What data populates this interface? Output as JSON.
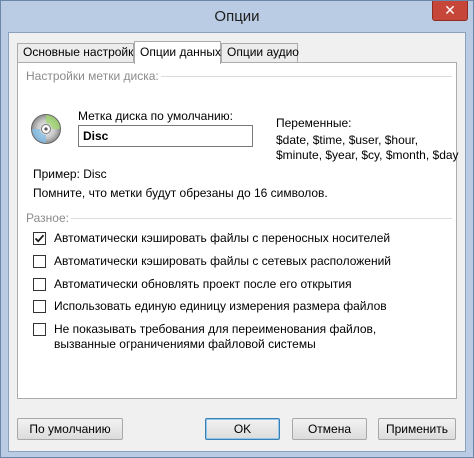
{
  "window": {
    "title": "Опции",
    "close_glyph": "✕"
  },
  "tabs": [
    {
      "label": "Основные настройки",
      "active": false
    },
    {
      "label": "Опции данных",
      "active": true
    },
    {
      "label": "Опции аудио",
      "active": false
    }
  ],
  "disc_label_group": {
    "title": "Настройки метки диска:",
    "default_label_caption": "Метка диска по умолчанию:",
    "default_label_value": "Disc",
    "variables_caption": "Переменные:",
    "variables_line1": "$date, $time, $user, $hour,",
    "variables_line2": "$minute, $year, $cy, $month, $day",
    "example": "Пример: Disc",
    "note": "Помните, что метки будут обрезаны до 16 символов."
  },
  "misc_group": {
    "title": "Разное:",
    "options": [
      {
        "label": "Автоматически кэшировать файлы с переносных носителей",
        "checked": true
      },
      {
        "label": "Автоматически кэшировать файлы с сетевых расположений",
        "checked": false
      },
      {
        "label": "Автоматически обновлять проект после его открытия",
        "checked": false
      },
      {
        "label": "Использовать единую единицу измерения размера файлов",
        "checked": false
      },
      {
        "label": "Не показывать требования для переименования файлов,",
        "label_line2": "вызванные ограничениями файловой системы",
        "checked": false
      }
    ]
  },
  "buttons": {
    "defaults": "По умолчанию",
    "ok": "OK",
    "cancel": "Отмена",
    "apply": "Применить"
  },
  "colors": {
    "frame": "#b9cce3",
    "close": "#c7463a",
    "default_button_border": "#3c7fb1"
  }
}
